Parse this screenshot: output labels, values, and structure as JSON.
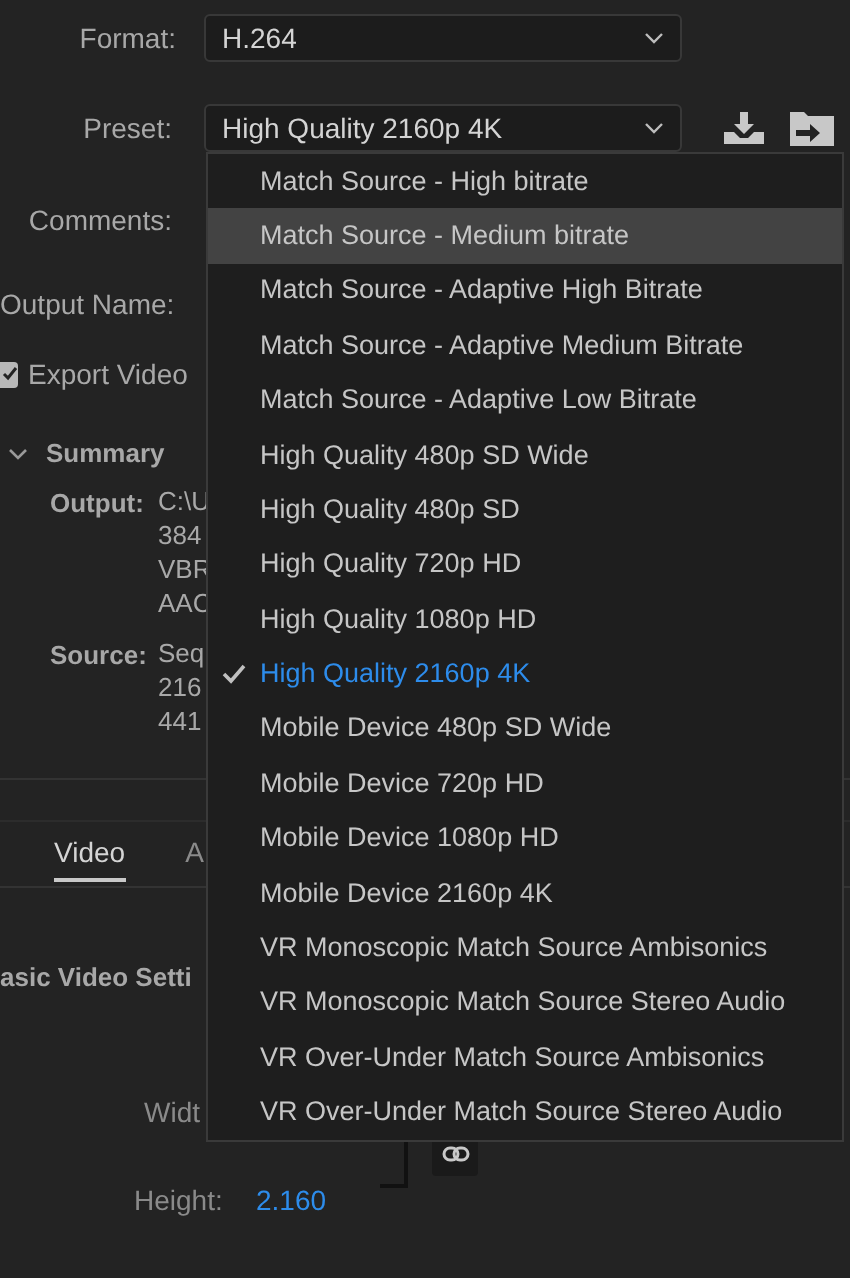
{
  "format": {
    "label": "Format:",
    "value": "H.264"
  },
  "preset": {
    "label": "Preset:",
    "value": "High Quality 2160p 4K"
  },
  "comments_label": "Comments:",
  "output_name_label": "Output Name:",
  "export_video": {
    "label": "Export Video",
    "checked": true
  },
  "summary": {
    "title": "Summary",
    "expanded": true,
    "output": {
      "label": "Output:",
      "lines": [
        "C:\\U",
        "384",
        "VBR",
        "AAC"
      ]
    },
    "source": {
      "label": "Source:",
      "lines": [
        "Seq",
        "216",
        "441"
      ]
    }
  },
  "tabs": [
    {
      "label": "Video",
      "selected": true
    },
    {
      "label": "A",
      "selected": false
    }
  ],
  "section_title": "asic Video Setti",
  "width_label": "Widt",
  "height": {
    "label": "Height:",
    "value": "2.160"
  },
  "preset_menu": {
    "items": [
      {
        "label": "Match Source - High bitrate",
        "selected": false,
        "highlighted": false
      },
      {
        "label": "Match Source - Medium bitrate",
        "selected": false,
        "highlighted": true
      },
      {
        "label": "Match Source - Adaptive High Bitrate",
        "selected": false,
        "highlighted": false
      },
      {
        "label": "Match Source - Adaptive Medium Bitrate",
        "selected": false,
        "highlighted": false
      },
      {
        "label": "Match Source - Adaptive Low Bitrate",
        "selected": false,
        "highlighted": false
      },
      {
        "label": "High Quality 480p SD Wide",
        "selected": false,
        "highlighted": false
      },
      {
        "label": "High Quality 480p SD",
        "selected": false,
        "highlighted": false
      },
      {
        "label": "High Quality 720p HD",
        "selected": false,
        "highlighted": false
      },
      {
        "label": "High Quality 1080p HD",
        "selected": false,
        "highlighted": false
      },
      {
        "label": "High Quality 2160p 4K",
        "selected": true,
        "highlighted": false
      },
      {
        "label": "Mobile Device 480p SD Wide",
        "selected": false,
        "highlighted": false
      },
      {
        "label": "Mobile Device 720p HD",
        "selected": false,
        "highlighted": false
      },
      {
        "label": "Mobile Device 1080p HD",
        "selected": false,
        "highlighted": false
      },
      {
        "label": "Mobile Device 2160p 4K",
        "selected": false,
        "highlighted": false
      },
      {
        "label": "VR Monoscopic Match Source Ambisonics",
        "selected": false,
        "highlighted": false
      },
      {
        "label": "VR Monoscopic Match Source Stereo Audio",
        "selected": false,
        "highlighted": false
      },
      {
        "label": "VR Over-Under Match Source Ambisonics",
        "selected": false,
        "highlighted": false
      },
      {
        "label": "VR Over-Under Match Source Stereo Audio",
        "selected": false,
        "highlighted": false
      }
    ]
  }
}
